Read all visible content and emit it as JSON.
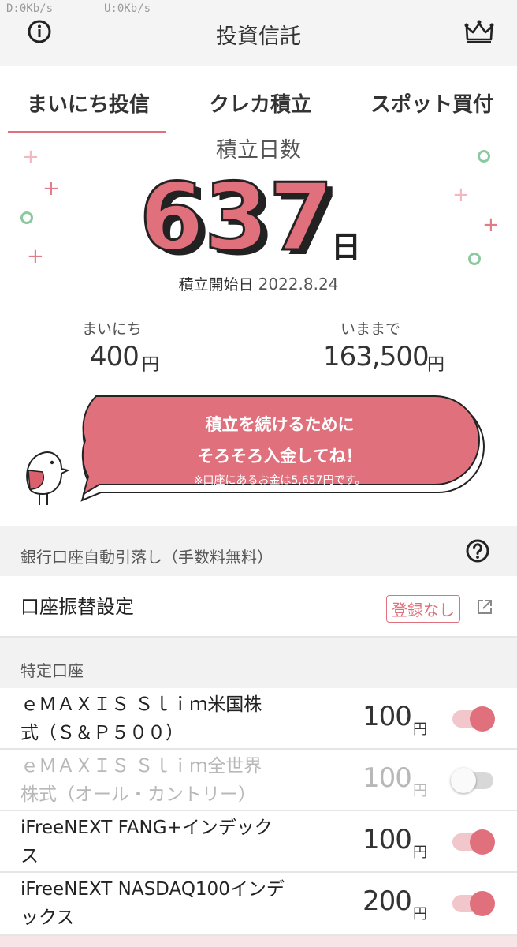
{
  "status_bar": {
    "download": "D:0Kb/s",
    "upload": "U:0Kb/s"
  },
  "header": {
    "title": "投資信託",
    "info_icon": "info-icon",
    "crown_icon": "crown-icon"
  },
  "tabs": [
    {
      "label": "まいにち投信",
      "active": true
    },
    {
      "label": "クレカ積立",
      "active": false
    },
    {
      "label": "スポット買付",
      "active": false
    }
  ],
  "summary": {
    "days_label": "積立日数",
    "days_value": "637",
    "days_unit": "日",
    "start_label": "積立開始日",
    "start_date": "2022.8.24",
    "daily_label": "まいにち",
    "daily_value": "400",
    "daily_unit": "円",
    "total_label": "いままで",
    "total_value": "163,500",
    "total_unit": "円"
  },
  "notice": {
    "line1": "積立を続けるために",
    "line2": "そろそろ入金してね！",
    "note": "※口座にあるお金は5,657円です。"
  },
  "bank_section": {
    "label": "銀行口座自動引落し（手数料無料）",
    "help_icon": "question-icon",
    "setting_label": "口座振替設定",
    "setting_status": "登録なし",
    "external_icon": "external-link-icon"
  },
  "funds_section": {
    "label": "特定口座",
    "funds": [
      {
        "line1": "ｅＭＡＸＩＳ Ｓｌｉｍ米国株",
        "line2": "式（Ｓ＆Ｐ５００）",
        "amount": "100",
        "unit": "円",
        "enabled": true
      },
      {
        "line1": "ｅＭＡＸＩＳ Ｓｌｉｍ全世界",
        "line2": "株式（オール・カントリー）",
        "amount": "100",
        "unit": "円",
        "enabled": false
      },
      {
        "line1": "iFreeNEXT FANG+インデック",
        "line2": "ス",
        "amount": "100",
        "unit": "円",
        "enabled": true
      },
      {
        "line1": "iFreeNEXT NASDAQ100インデ",
        "line2": "ックス",
        "amount": "200",
        "unit": "円",
        "enabled": true
      }
    ]
  },
  "colors": {
    "accent": "#e0707c",
    "accent_light": "#f2c7cc",
    "green": "#8cc9a0"
  }
}
